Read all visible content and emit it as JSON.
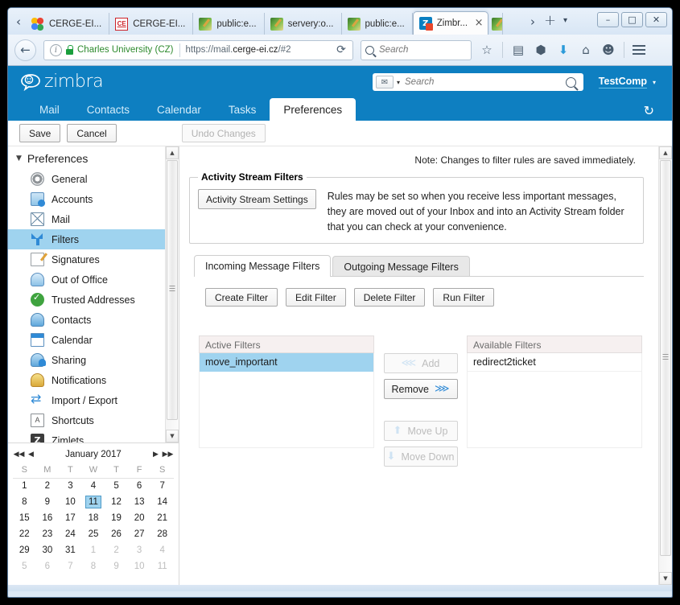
{
  "browser": {
    "tabs": [
      {
        "label": "CERGE-EI...",
        "favicon": "chrome-colors-icon",
        "active": false
      },
      {
        "label": "CERGE-EI...",
        "favicon": "ce-letters-icon",
        "active": false
      },
      {
        "label": "public:e...",
        "favicon": "dokuwiki-icon",
        "active": false
      },
      {
        "label": "servery:o...",
        "favicon": "dokuwiki-icon",
        "active": false
      },
      {
        "label": "public:e...",
        "favicon": "dokuwiki-icon",
        "active": false
      },
      {
        "label": "Zimbr...",
        "favicon": "zimbra-icon",
        "active": true,
        "close_label": "×"
      }
    ],
    "scroll_left_label": "‹",
    "scroll_right_label": "›",
    "new_tab_label": "+",
    "tab_list_label": "▾",
    "window_controls": {
      "minimize": "–",
      "maximize": "□",
      "close": "✕"
    },
    "nav": {
      "back_label": "←",
      "identity": "Charles University (CZ)",
      "url_prefix": "https://mail.",
      "url_domain": "cerge-ei.cz",
      "url_suffix": "/#2",
      "reload_label": "⟳",
      "search_value": "",
      "search_placeholder": "Search",
      "icons": [
        "star-icon",
        "library-icon",
        "pocket-icon",
        "download-icon",
        "home-icon",
        "hello-icon",
        "menu-icon"
      ]
    }
  },
  "zimbra": {
    "brand": "zimbra",
    "search": {
      "value": "",
      "placeholder": "Search",
      "type_label": "✉",
      "caret": "▾"
    },
    "user": {
      "name": "TestComp",
      "caret": "▾"
    },
    "refresh_label": "↻",
    "app_tabs": [
      {
        "label": "Mail",
        "active": false
      },
      {
        "label": "Contacts",
        "active": false
      },
      {
        "label": "Calendar",
        "active": false
      },
      {
        "label": "Tasks",
        "active": false
      },
      {
        "label": "Preferences",
        "active": true
      }
    ],
    "toolbar": {
      "save_label": "Save",
      "cancel_label": "Cancel",
      "undo_label": "Undo Changes"
    },
    "sidebar": {
      "header": "Preferences",
      "header_caret": "▼",
      "items": [
        {
          "label": "General",
          "icon": "gear-icon",
          "selected": false
        },
        {
          "label": "Accounts",
          "icon": "accounts-icon",
          "selected": false
        },
        {
          "label": "Mail",
          "icon": "mail-icon",
          "selected": false
        },
        {
          "label": "Filters",
          "icon": "filter-icon",
          "selected": true
        },
        {
          "label": "Signatures",
          "icon": "signature-icon",
          "selected": false
        },
        {
          "label": "Out of Office",
          "icon": "out-of-office-icon",
          "selected": false
        },
        {
          "label": "Trusted Addresses",
          "icon": "shield-check-icon",
          "selected": false
        },
        {
          "label": "Contacts",
          "icon": "contacts-icon",
          "selected": false
        },
        {
          "label": "Calendar",
          "icon": "calendar-icon",
          "selected": false
        },
        {
          "label": "Sharing",
          "icon": "sharing-icon",
          "selected": false
        },
        {
          "label": "Notifications",
          "icon": "bell-icon",
          "selected": false
        },
        {
          "label": "Import / Export",
          "icon": "import-export-icon",
          "selected": false
        },
        {
          "label": "Shortcuts",
          "icon": "shortcuts-icon",
          "selected": false
        },
        {
          "label": "Zimlets",
          "icon": "zimlets-icon",
          "selected": false
        }
      ]
    },
    "calendar": {
      "title": "January 2017",
      "nav": {
        "prev_year": "◀◀",
        "prev_month": "◀",
        "next_month": "▶",
        "next_year": "▶▶"
      },
      "weekdays": [
        "S",
        "M",
        "T",
        "W",
        "T",
        "F",
        "S"
      ],
      "weeks": [
        [
          {
            "d": "1"
          },
          {
            "d": "2"
          },
          {
            "d": "3"
          },
          {
            "d": "4"
          },
          {
            "d": "5"
          },
          {
            "d": "6"
          },
          {
            "d": "7"
          }
        ],
        [
          {
            "d": "8"
          },
          {
            "d": "9"
          },
          {
            "d": "10"
          },
          {
            "d": "11",
            "today": true
          },
          {
            "d": "12"
          },
          {
            "d": "13"
          },
          {
            "d": "14"
          }
        ],
        [
          {
            "d": "15"
          },
          {
            "d": "16"
          },
          {
            "d": "17"
          },
          {
            "d": "18"
          },
          {
            "d": "19"
          },
          {
            "d": "20"
          },
          {
            "d": "21"
          }
        ],
        [
          {
            "d": "22"
          },
          {
            "d": "23"
          },
          {
            "d": "24"
          },
          {
            "d": "25"
          },
          {
            "d": "26"
          },
          {
            "d": "27"
          },
          {
            "d": "28"
          }
        ],
        [
          {
            "d": "29"
          },
          {
            "d": "30"
          },
          {
            "d": "31"
          },
          {
            "d": "1",
            "other": true
          },
          {
            "d": "2",
            "other": true
          },
          {
            "d": "3",
            "other": true
          },
          {
            "d": "4",
            "other": true
          }
        ],
        [
          {
            "d": "5",
            "other": true
          },
          {
            "d": "6",
            "other": true
          },
          {
            "d": "7",
            "other": true
          },
          {
            "d": "8",
            "other": true
          },
          {
            "d": "9",
            "other": true
          },
          {
            "d": "10",
            "other": true
          },
          {
            "d": "11",
            "other": true
          }
        ]
      ]
    },
    "content": {
      "note": "Note: Changes to filter rules are saved immediately.",
      "activity_stream": {
        "legend": "Activity Stream Filters",
        "settings_button": "Activity Stream Settings",
        "description": "Rules may be set so when you receive less important messages, they are moved out of your Inbox and into an Activity Stream folder that you can check at your convenience."
      },
      "filter_tabs": [
        {
          "label": "Incoming Message Filters",
          "active": true
        },
        {
          "label": "Outgoing Message Filters",
          "active": false
        }
      ],
      "filter_buttons": [
        {
          "label": "Create Filter"
        },
        {
          "label": "Edit Filter"
        },
        {
          "label": "Delete Filter"
        },
        {
          "label": "Run Filter"
        }
      ],
      "active_filters": {
        "header": "Active Filters",
        "rows": [
          {
            "label": "move_important",
            "selected": true
          }
        ]
      },
      "available_filters": {
        "header": "Available Filters",
        "rows": [
          {
            "label": "redirect2ticket",
            "selected": false
          }
        ]
      },
      "transfer_buttons": [
        {
          "label": "Add",
          "icon": "double-arrow-left-icon",
          "disabled": true,
          "icon_side": "left"
        },
        {
          "label": "Remove",
          "icon": "double-arrow-right-icon",
          "disabled": false,
          "icon_side": "right"
        },
        {
          "label": "Move Up",
          "icon": "arrow-up-icon",
          "disabled": true,
          "icon_side": "left"
        },
        {
          "label": "Move Down",
          "icon": "arrow-down-icon",
          "disabled": true,
          "icon_side": "left"
        }
      ]
    }
  },
  "colors": {
    "zimbra_blue": "#0e7fc1",
    "selection_blue": "#9fd3ef",
    "accent_arrow": "#2f8ad6"
  }
}
